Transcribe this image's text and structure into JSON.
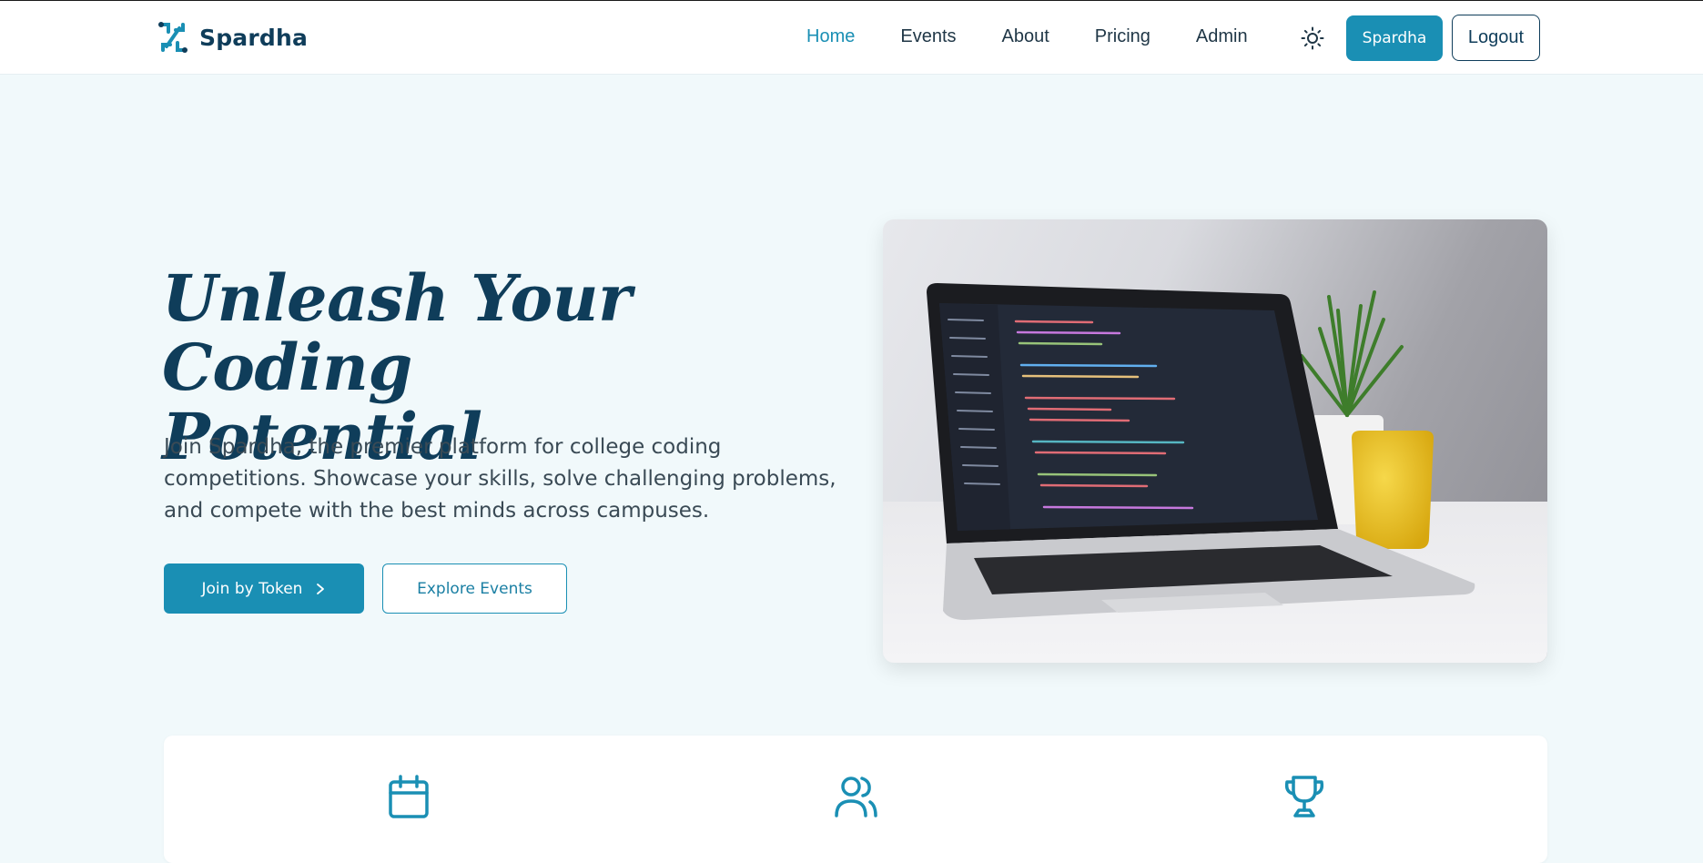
{
  "nav": {
    "brand": "Spardha",
    "links": [
      {
        "label": "Home",
        "active": true
      },
      {
        "label": "Events",
        "active": false
      },
      {
        "label": "About",
        "active": false
      },
      {
        "label": "Pricing",
        "active": false
      },
      {
        "label": "Admin",
        "active": false
      }
    ],
    "theme_icon": "sun-icon",
    "user_button": "Spardha",
    "logout_button": "Logout"
  },
  "hero": {
    "title_line1": "Unleash Your Coding",
    "title_line2": "Potential",
    "description": "Join Spardha, the premier platform for college coding competitions. Showcase your skills, solve challenging problems, and compete with the best minds across campuses.",
    "primary_button": "Join by Token",
    "primary_icon": "chevron-right-icon",
    "secondary_button": "Explore Events",
    "image": "laptop-with-code-photo"
  },
  "features": {
    "icons": [
      "calendar-icon",
      "users-icon",
      "trophy-icon"
    ]
  },
  "colors": {
    "accent": "#1a8fb4",
    "heading": "#0f3d5a",
    "page_bg": "#f1f9fb"
  }
}
